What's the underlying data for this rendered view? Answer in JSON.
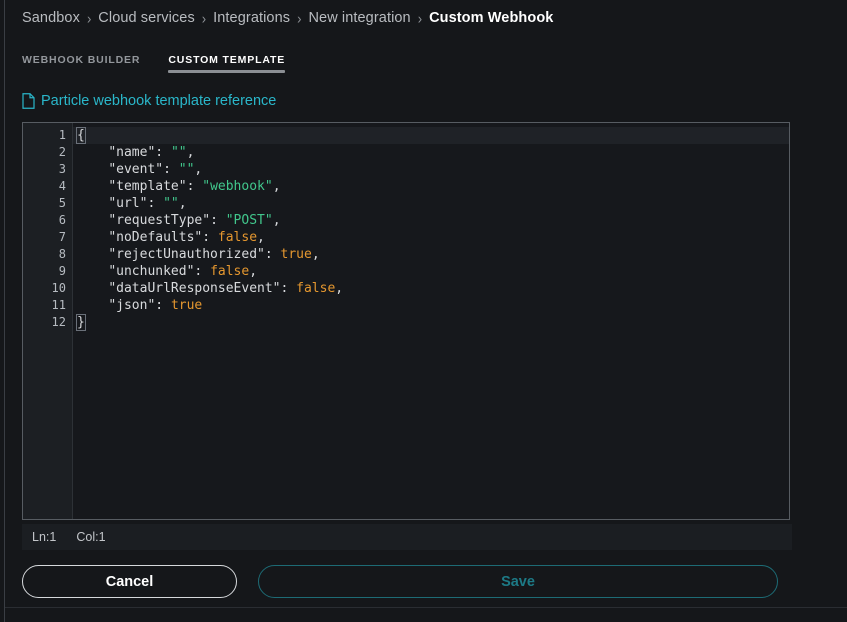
{
  "breadcrumb": {
    "separator": "›",
    "items": [
      {
        "label": "Sandbox",
        "current": false
      },
      {
        "label": "Cloud services",
        "current": false
      },
      {
        "label": "Integrations",
        "current": false
      },
      {
        "label": "New integration",
        "current": false
      },
      {
        "label": "Custom Webhook",
        "current": true
      }
    ]
  },
  "tabs": [
    {
      "label": "WEBHOOK BUILDER",
      "active": false
    },
    {
      "label": "CUSTOM TEMPLATE",
      "active": true
    }
  ],
  "reference_link": {
    "label": "Particle webhook template reference",
    "icon": "document-icon",
    "color": "#2ab7ca"
  },
  "editor": {
    "language": "json",
    "lines": [
      {
        "number": 1,
        "text": "{",
        "foldable": true
      },
      {
        "number": 2,
        "text": "    \"name\": \"\",",
        "foldable": false
      },
      {
        "number": 3,
        "text": "    \"event\": \"\",",
        "foldable": false
      },
      {
        "number": 4,
        "text": "    \"template\": \"webhook\",",
        "foldable": false
      },
      {
        "number": 5,
        "text": "    \"url\": \"\",",
        "foldable": false
      },
      {
        "number": 6,
        "text": "    \"requestType\": \"POST\",",
        "foldable": false
      },
      {
        "number": 7,
        "text": "    \"noDefaults\": false,",
        "foldable": false
      },
      {
        "number": 8,
        "text": "    \"rejectUnauthorized\": true,",
        "foldable": false
      },
      {
        "number": 9,
        "text": "    \"unchunked\": false,",
        "foldable": false
      },
      {
        "number": 10,
        "text": "    \"dataUrlResponseEvent\": false,",
        "foldable": false
      },
      {
        "number": 11,
        "text": "    \"json\": true",
        "foldable": false
      },
      {
        "number": 12,
        "text": "}",
        "foldable": false
      }
    ],
    "template_object": {
      "name": "",
      "event": "",
      "template": "webhook",
      "url": "",
      "requestType": "POST",
      "noDefaults": false,
      "rejectUnauthorized": true,
      "unchunked": false,
      "dataUrlResponseEvent": false,
      "json": true
    },
    "syntax_colors": {
      "key": "#d8dadd",
      "string": "#41c78c",
      "boolean": "#e5972f",
      "punctuation": "#d8dadd",
      "background": "#16181c",
      "gutter_background": "#1c1f23",
      "line_number": "#b6bbc1"
    },
    "fold_arrow_glyph": "▾"
  },
  "status_bar": {
    "line": "Ln:1",
    "column": "Col:1"
  },
  "buttons": {
    "cancel": "Cancel",
    "save": "Save"
  }
}
